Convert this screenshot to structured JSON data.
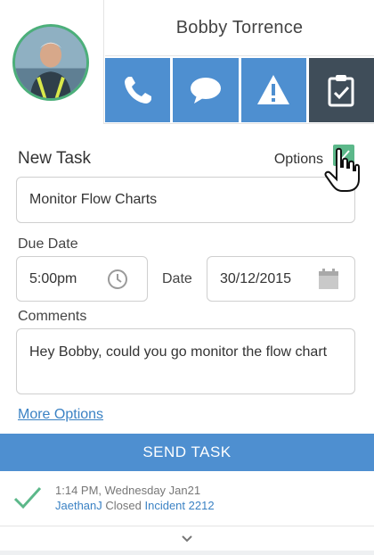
{
  "contact": {
    "name": "Bobby Torrence"
  },
  "actions": {
    "call_icon": "phone-icon",
    "message_icon": "chat-bubble-icon",
    "alert_icon": "warning-icon",
    "task_icon": "clipboard-check-icon"
  },
  "form": {
    "title": "New Task",
    "options_label": "Options",
    "options_checked": true,
    "task_value": "Monitor Flow Charts",
    "due_label": "Due Date",
    "time_value": "5:00pm",
    "date_label": "Date",
    "date_value": "30/12/2015",
    "comments_label": "Comments",
    "comments_value": "Hey Bobby, could you go monitor the flow chart",
    "more_options": "More Options"
  },
  "send_button": "SEND TASK",
  "activity": {
    "timestamp": "1:14 PM, Wednesday Jan21",
    "user": "JaethanJ",
    "action": "Closed",
    "target": "Incident 2212"
  },
  "colors": {
    "primary": "#4e8fd0",
    "dark": "#3f4d59",
    "success": "#5cb88a",
    "link": "#3b82c4"
  }
}
